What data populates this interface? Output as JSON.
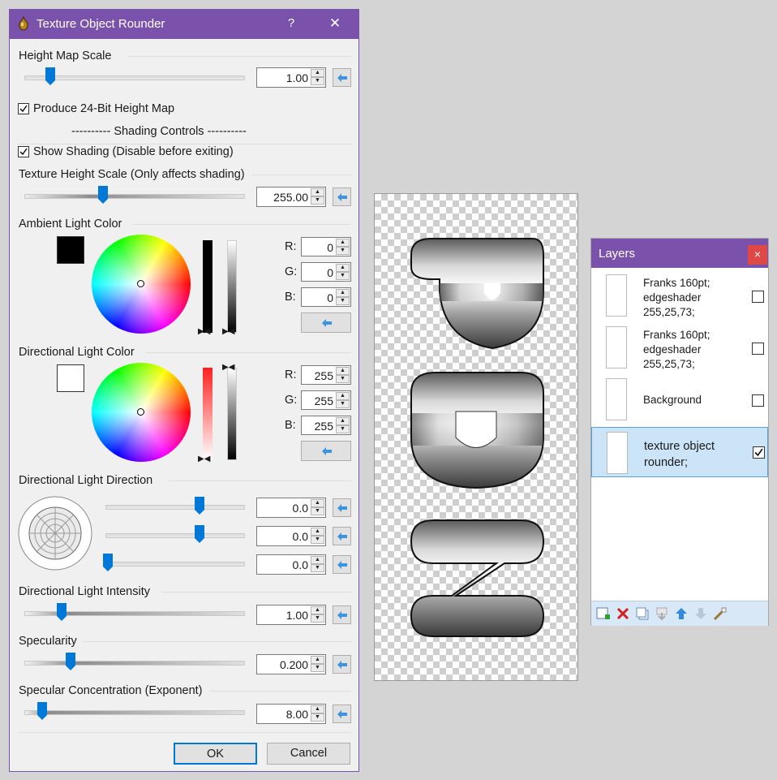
{
  "dialog": {
    "title": "Texture Object Rounder",
    "help_label": "?",
    "close_label": "✕",
    "height_map_scale": {
      "label": "Height Map Scale",
      "value": "1.00",
      "level": 0.12
    },
    "produce_24bit": {
      "label": "Produce 24-Bit Height Map",
      "checked": true
    },
    "shading_header": "---------- Shading Controls ----------",
    "show_shading": {
      "label": "Show Shading (Disable before exiting)",
      "checked": true
    },
    "texture_height_scale": {
      "label": "Texture Height Scale (Only affects shading)",
      "value": "255.00",
      "level": 0.36
    },
    "ambient": {
      "label": "Ambient Light Color",
      "swatch_color": "#000000",
      "r_label": "R:",
      "r": "0",
      "g_label": "G:",
      "g": "0",
      "b_label": "B:",
      "b": "0"
    },
    "directional": {
      "label": "Directional Light Color",
      "swatch_color": "#ffffff",
      "r_label": "R:",
      "r": "255",
      "g_label": "G:",
      "g": "255",
      "b_label": "B:",
      "b": "255"
    },
    "direction": {
      "label": "Directional Light Direction",
      "values": [
        "0.0",
        "0.0",
        "0.0"
      ],
      "levels": [
        0.68,
        0.68,
        0.02
      ]
    },
    "intensity": {
      "label": "Directional Light Intensity",
      "value": "1.00",
      "level": 0.17
    },
    "specularity": {
      "label": "Specularity",
      "value": "0.200",
      "level": 0.21
    },
    "concentration": {
      "label": "Specular Concentration (Exponent)",
      "value": "8.00",
      "level": 0.08
    },
    "ok_label": "OK",
    "cancel_label": "Cancel",
    "accent_color": "#7b52ab",
    "slider_color": "#0078d7"
  },
  "layers": {
    "title": "Layers",
    "close_label": "×",
    "items": [
      {
        "name": "Franks 160pt; edgeshader 255,25,73;",
        "checked": false,
        "selected": false
      },
      {
        "name": "Franks 160pt; edgeshader 255,25,73;",
        "checked": false,
        "selected": false
      },
      {
        "name": "Background",
        "checked": false,
        "selected": false
      },
      {
        "name": "texture object rounder;",
        "checked": true,
        "selected": true
      }
    ],
    "toolbar_icons": [
      "add-layer-icon",
      "delete-layer-icon",
      "duplicate-layer-icon",
      "merge-down-icon",
      "move-up-icon",
      "move-down-icon",
      "properties-icon"
    ]
  }
}
